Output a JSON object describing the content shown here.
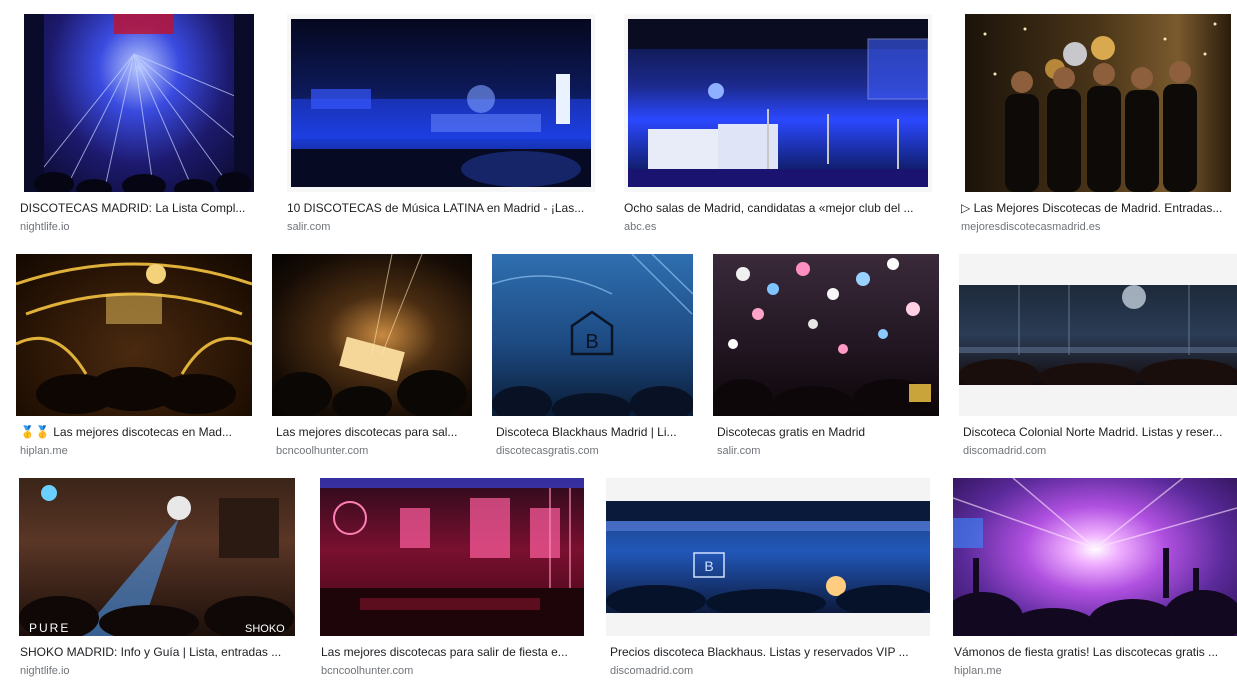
{
  "results": [
    {
      "title": "DISCOTECAS MADRID: La Lista Compl...",
      "source": "nightlife.io"
    },
    {
      "title": "10 DISCOTECAS de Música LATINA en Madrid - ¡Las...",
      "source": "salir.com"
    },
    {
      "title": "Ocho salas de Madrid, candidatas a «mejor club del ...",
      "source": "abc.es"
    },
    {
      "title": "▷ Las Mejores Discotecas de Madrid. Entradas...",
      "source": "mejoresdiscotecasmadrid.es"
    },
    {
      "title": "🥇🥇 Las mejores discotecas en Mad...",
      "source": "hiplan.me"
    },
    {
      "title": "Las mejores discotecas para sal...",
      "source": "bcncoolhunter.com"
    },
    {
      "title": "Discoteca Blackhaus Madrid | Li...",
      "source": "discotecasgratis.com"
    },
    {
      "title": "Discotecas gratis en Madrid",
      "source": "salir.com"
    },
    {
      "title": "Discoteca Colonial Norte Madrid. Listas y reser...",
      "source": "discomadrid.com"
    },
    {
      "title": "SHOKO MADRID: Info y Guía | Lista, entradas ...",
      "source": "nightlife.io",
      "overlay_left": "PURE",
      "overlay_right": "SHOKO"
    },
    {
      "title": "Las mejores discotecas para salir de fiesta e...",
      "source": "bcncoolhunter.com"
    },
    {
      "title": "Precios discoteca Blackhaus. Listas y reservados VIP ...",
      "source": "discomadrid.com",
      "logo_letter": "B"
    },
    {
      "title": "Vámonos de fiesta gratis! Las discotecas gratis ...",
      "source": "hiplan.me"
    }
  ],
  "logos": {
    "blackhaus_letter": "B"
  }
}
